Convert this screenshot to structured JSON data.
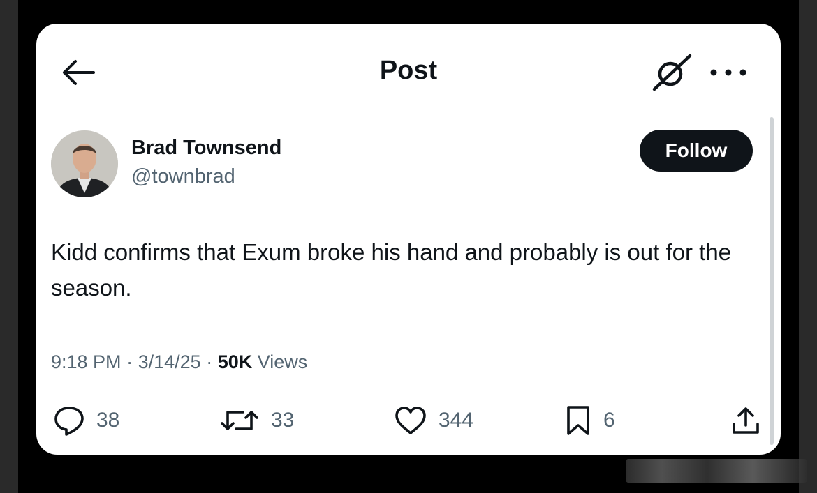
{
  "header": {
    "title": "Post",
    "back_icon": "arrow-left-icon",
    "grok_icon": "grok-icon",
    "more_icon": "more-dots-icon"
  },
  "author": {
    "display_name": "Brad Townsend",
    "handle": "@townbrad",
    "follow_label": "Follow"
  },
  "post": {
    "text": "Kidd confirms that Exum broke his hand and probably is out for the season.",
    "time": "9:18 PM",
    "date": "3/14/25",
    "separator": "·",
    "views_count": "50K",
    "views_label": "Views"
  },
  "actions": {
    "replies": "38",
    "reposts": "33",
    "likes": "344",
    "bookmarks": "6"
  },
  "colors": {
    "text_primary": "#0f1419",
    "text_secondary": "#536471",
    "follow_bg": "#0f1419",
    "card_bg": "#ffffff",
    "page_bg": "#000000"
  }
}
